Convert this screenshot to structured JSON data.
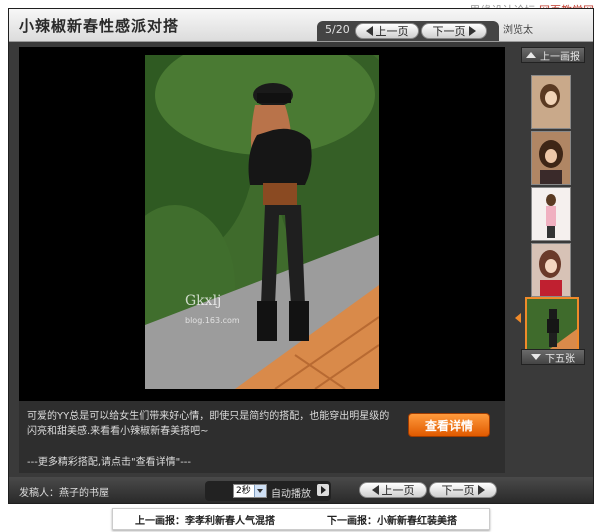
{
  "watermark": {
    "text_a": "思缘设计论坛",
    "text_b": "网页教学网"
  },
  "header": {
    "title": "小辣椒新春性感派对搭",
    "counter": "5/20",
    "prev_label": "上一页",
    "next_label": "下一页",
    "browse_label": "浏览太"
  },
  "description": {
    "text": "可爱的YY总是可以给女生们带来好心情，即使只是简约的搭配，也能穿出明星级的闪亮和甜美感.来看看小辣椒新春美搭吧~",
    "more": "---更多精彩搭配,请点击\"查看详情\"---",
    "detail_button": "查看详情"
  },
  "footer": {
    "poster": "发稿人：燕子的书屋",
    "interval": "2秒",
    "autoplay_label": "自动播放",
    "prev_label": "上一页",
    "next_label": "下一页"
  },
  "sidebar": {
    "prev_group": "上一画报",
    "next_group": "下五张"
  },
  "photo": {
    "watermark": "Gkxlj",
    "site": "blog.163.com"
  },
  "links": {
    "prev": "上一画报：李孝利新春人气混搭",
    "next": "下一画报：小新新春红装美搭"
  },
  "colors": {
    "accent": "#f08a2a",
    "panel": "#3a3a3a"
  }
}
